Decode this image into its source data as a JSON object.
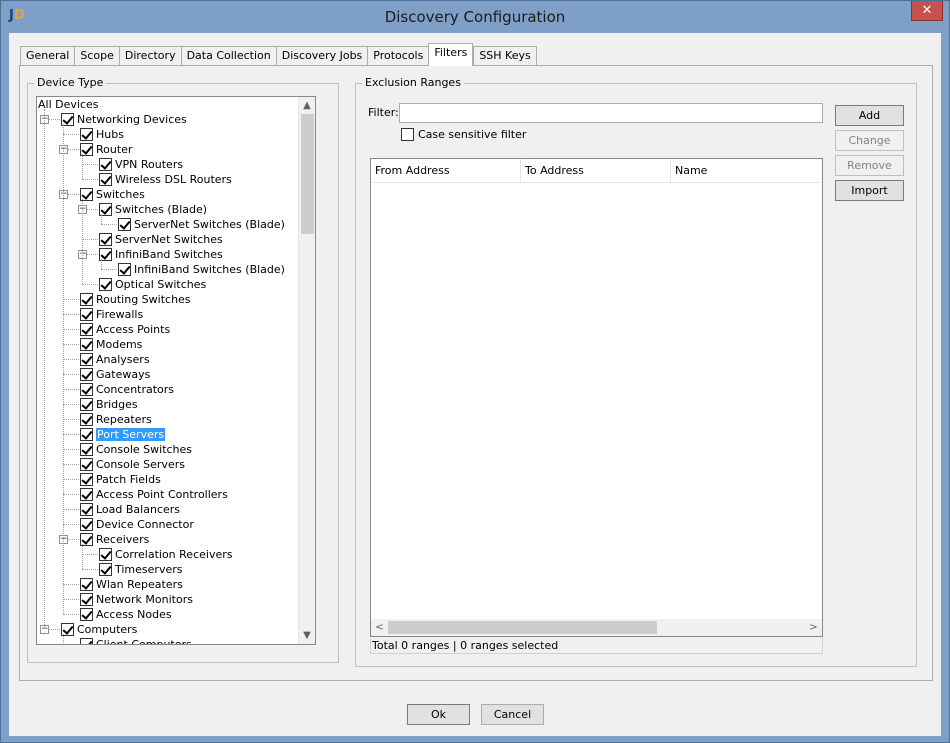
{
  "window": {
    "title": "Discovery Configuration",
    "close_glyph": "✕"
  },
  "tabs": [
    "General",
    "Scope",
    "Directory",
    "Data Collection",
    "Discovery Jobs",
    "Protocols",
    "Filters",
    "SSH Keys"
  ],
  "active_tab": "Filters",
  "device_type": {
    "legend": "Device Type",
    "tree": [
      {
        "label": "All Devices",
        "level": 0,
        "checkbox": false,
        "expander": false
      },
      {
        "label": "Networking Devices",
        "level": 1,
        "checked": true,
        "expander": true
      },
      {
        "label": "Hubs",
        "level": 2,
        "checked": true
      },
      {
        "label": "Router",
        "level": 2,
        "checked": true,
        "expander": true
      },
      {
        "label": "VPN Routers",
        "level": 3,
        "checked": true
      },
      {
        "label": "Wireless DSL Routers",
        "level": 3,
        "checked": true
      },
      {
        "label": "Switches",
        "level": 2,
        "checked": true,
        "expander": true
      },
      {
        "label": "Switches (Blade)",
        "level": 3,
        "checked": true,
        "expander": true
      },
      {
        "label": "ServerNet Switches (Blade)",
        "level": 4,
        "checked": true
      },
      {
        "label": "ServerNet Switches",
        "level": 3,
        "checked": true
      },
      {
        "label": "InfiniBand Switches",
        "level": 3,
        "checked": true,
        "expander": true
      },
      {
        "label": "InfiniBand Switches (Blade)",
        "level": 4,
        "checked": true
      },
      {
        "label": "Optical Switches",
        "level": 3,
        "checked": true
      },
      {
        "label": "Routing Switches",
        "level": 2,
        "checked": true
      },
      {
        "label": "Firewalls",
        "level": 2,
        "checked": true
      },
      {
        "label": "Access Points",
        "level": 2,
        "checked": true
      },
      {
        "label": "Modems",
        "level": 2,
        "checked": true
      },
      {
        "label": "Analysers",
        "level": 2,
        "checked": true
      },
      {
        "label": "Gateways",
        "level": 2,
        "checked": true
      },
      {
        "label": "Concentrators",
        "level": 2,
        "checked": true
      },
      {
        "label": "Bridges",
        "level": 2,
        "checked": true
      },
      {
        "label": "Repeaters",
        "level": 2,
        "checked": true
      },
      {
        "label": "Port Servers",
        "level": 2,
        "checked": true,
        "selected": true
      },
      {
        "label": "Console Switches",
        "level": 2,
        "checked": true
      },
      {
        "label": "Console Servers",
        "level": 2,
        "checked": true
      },
      {
        "label": "Patch Fields",
        "level": 2,
        "checked": true
      },
      {
        "label": "Access Point Controllers",
        "level": 2,
        "checked": true
      },
      {
        "label": "Load Balancers",
        "level": 2,
        "checked": true
      },
      {
        "label": "Device Connector",
        "level": 2,
        "checked": true
      },
      {
        "label": "Receivers",
        "level": 2,
        "checked": true,
        "expander": true
      },
      {
        "label": "Correlation Receivers",
        "level": 3,
        "checked": true
      },
      {
        "label": "Timeservers",
        "level": 3,
        "checked": true
      },
      {
        "label": "Wlan Repeaters",
        "level": 2,
        "checked": true
      },
      {
        "label": "Network Monitors",
        "level": 2,
        "checked": true
      },
      {
        "label": "Access Nodes",
        "level": 2,
        "checked": true
      },
      {
        "label": "Computers",
        "level": 1,
        "checked": true,
        "expander": true
      },
      {
        "label": "Client Computers",
        "level": 2,
        "checked": true
      }
    ]
  },
  "exclusion": {
    "legend": "Exclusion Ranges",
    "filter_label": "Filter:",
    "filter_value": "",
    "case_sensitive_label": "Case sensitive filter",
    "case_sensitive_checked": false,
    "buttons": {
      "add": "Add",
      "change": "Change",
      "remove": "Remove",
      "import": "Import"
    },
    "columns": [
      "From Address",
      "To Address",
      "Name"
    ],
    "rows": [],
    "status": "Total 0 ranges | 0 ranges selected"
  },
  "footer": {
    "ok": "Ok",
    "cancel": "Cancel"
  }
}
